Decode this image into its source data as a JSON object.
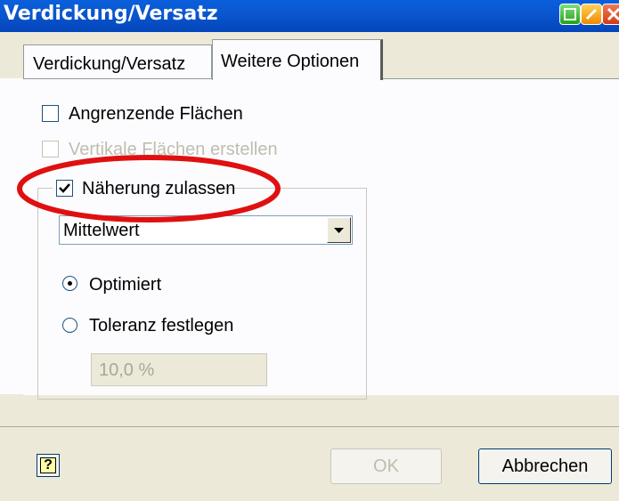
{
  "window": {
    "title": "Verdickung/Versatz"
  },
  "tabs": [
    {
      "label": "Verdickung/Versatz",
      "active": false
    },
    {
      "label": "Weitere Optionen",
      "active": true
    }
  ],
  "options": {
    "adjacent_faces": {
      "label": "Angrenzende Flächen",
      "checked": false,
      "enabled": true
    },
    "vertical_faces": {
      "label": "Vertikale Flächen erstellen",
      "checked": false,
      "enabled": false
    }
  },
  "approximation": {
    "label": "Näherung zulassen",
    "checked": true,
    "method": {
      "selected": "Mittelwert"
    },
    "optimized": {
      "label": "Optimiert",
      "selected": true
    },
    "tolerance": {
      "label": "Toleranz festlegen",
      "selected": false,
      "value": "10,0 %"
    }
  },
  "buttons": {
    "help": "?",
    "ok": "OK",
    "cancel": "Abbrechen"
  },
  "colors": {
    "title_bar": "#0b57d0",
    "highlight": "#e01010",
    "dialog_bg": "#ece9d8"
  }
}
